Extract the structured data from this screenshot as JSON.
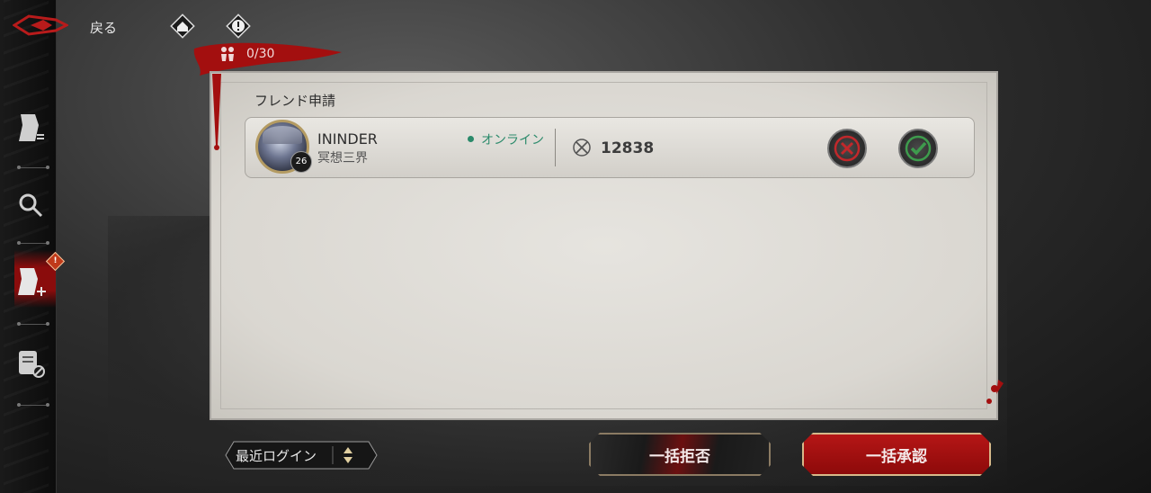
{
  "nav": {
    "back_label": "戻る"
  },
  "counter": {
    "text": "0/30"
  },
  "panel": {
    "title": "フレンド申請"
  },
  "requests": [
    {
      "name": "ININDER",
      "guild": "冥想三界",
      "level": "26",
      "status": "オンライン",
      "power": "12838"
    }
  ],
  "sort": {
    "label": "最近ログイン"
  },
  "actions": {
    "reject_all": "一括拒否",
    "accept_all": "一括承認"
  },
  "colors": {
    "accent_red": "#a30f0f",
    "online": "#2a8a6a",
    "reject": "#c0282b",
    "accept": "#3e9b4d"
  },
  "icons": {
    "sidebar": [
      "friend-list-icon",
      "search-icon",
      "friend-request-icon",
      "blocked-list-icon"
    ],
    "top": [
      "home-icon",
      "info-icon"
    ]
  },
  "sidebar_badge": "!"
}
